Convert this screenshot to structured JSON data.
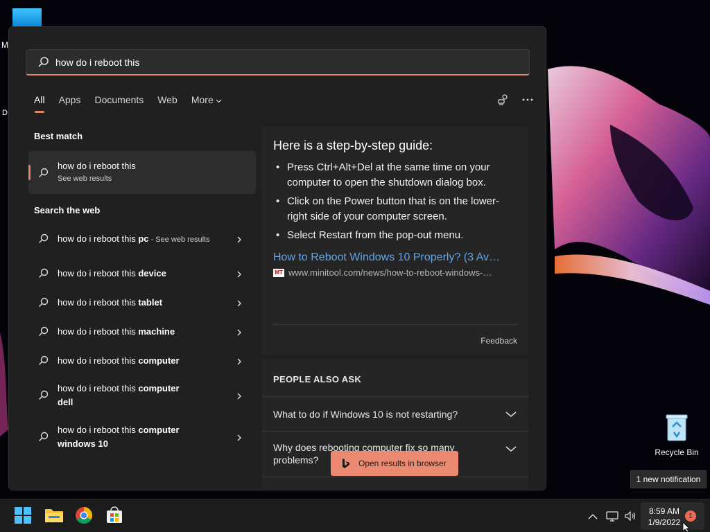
{
  "desktop": {
    "fragment_m": "M",
    "fragment_d": "D",
    "recycle_bin_label": "Recycle Bin",
    "notification_tip": "1 new notification"
  },
  "search": {
    "query": "how do i reboot this",
    "tabs": [
      {
        "label": "All",
        "active": true
      },
      {
        "label": "Apps"
      },
      {
        "label": "Documents"
      },
      {
        "label": "Web"
      },
      {
        "label": "More"
      }
    ],
    "toolbar_icons": [
      "feedback-icon",
      "more-options-icon"
    ],
    "best_match": {
      "title": "Best match",
      "item_title": "how do i reboot this",
      "item_sub": "See web results"
    },
    "search_web_title": "Search the web",
    "web_items": [
      {
        "prefix": "how do i reboot this ",
        "bold": "pc",
        "sub": " - See web results"
      },
      {
        "prefix": "how do i reboot this ",
        "bold": "device"
      },
      {
        "prefix": "how do i reboot this ",
        "bold": "tablet"
      },
      {
        "prefix": "how do i reboot this ",
        "bold": "machine"
      },
      {
        "prefix": "how do i reboot this ",
        "bold": "computer"
      },
      {
        "prefix": "how do i reboot this ",
        "bold": "computer dell"
      },
      {
        "prefix": "how do i reboot this ",
        "bold": "computer windows 10"
      }
    ],
    "guide": {
      "heading": "Here is a step-by-step guide:",
      "steps": [
        "Press Ctrl+Alt+Del at the same time on your computer to open the shutdown dialog box.",
        "Click on the Power button that is on the lower-right side of your computer screen.",
        "Select Restart from the pop-out menu."
      ],
      "link_text": "How to Reboot Windows 10 Properly? (3 Av…",
      "source_favicon": "MT",
      "source_url": "www.minitool.com/news/how-to-reboot-windows-…",
      "feedback": "Feedback"
    },
    "people_also_ask": {
      "title": "PEOPLE ALSO ASK",
      "questions": [
        "What to do if Windows 10 is not restarting?",
        "Why does rebooting computer fix so many problems?"
      ]
    },
    "open_browser_label": "Open results in browser"
  },
  "taskbar": {
    "apps": [
      "start-icon",
      "file-explorer-icon",
      "chrome-icon",
      "store-icon"
    ],
    "tray_icons": [
      "chevron-up-icon",
      "network-icon",
      "volume-icon"
    ],
    "time": "8:59 AM",
    "date": "1/9/2022",
    "notification_count": "1"
  },
  "colors": {
    "accent": "#e8836b",
    "panel_bg": "#202020",
    "card_bg": "#252525",
    "link": "#62a6e8",
    "taskbar_bg": "#1c1c1c"
  }
}
